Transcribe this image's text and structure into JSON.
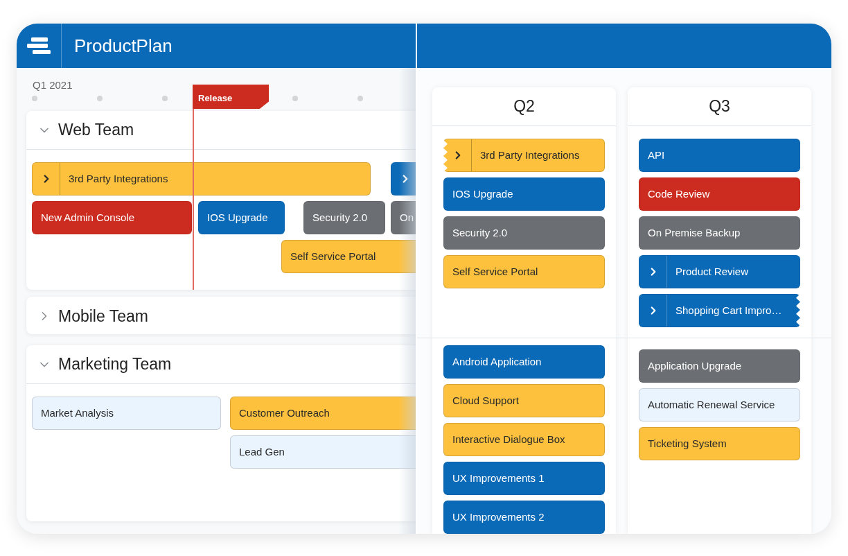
{
  "app": {
    "title": "ProductPlan"
  },
  "timeline": {
    "quarters": [
      "Q1 2021"
    ],
    "marker": {
      "label": "Release"
    },
    "teams": [
      {
        "name": "Web Team",
        "expanded": true,
        "bars": [
          {
            "label": "3rd Party Integrations",
            "color": "#fdc13e",
            "expandable": true
          },
          {
            "color": "#0b6ab7",
            "expandable": true
          },
          {
            "label": "New Admin Console",
            "color": "#cc2b1f",
            "expandable": false
          },
          {
            "label": "IOS Upgrade",
            "color": "#0b6ab7",
            "expandable": false
          },
          {
            "label": "Security 2.0",
            "color": "#6b6e72",
            "expandable": false
          },
          {
            "label": "On",
            "color": "#6b6e72",
            "expandable": false
          },
          {
            "label": "Self Service Portal",
            "color": "#fdc13e",
            "expandable": false
          }
        ]
      },
      {
        "name": "Mobile Team",
        "expanded": false
      },
      {
        "name": "Marketing Team",
        "expanded": true,
        "bars": [
          {
            "label": "Market Analysis",
            "color": "#eaf4fe",
            "expandable": false
          },
          {
            "label": "Customer Outreach",
            "color": "#fdc13e",
            "expandable": false
          },
          {
            "label": "Lead Gen",
            "color": "#eaf4fe",
            "expandable": false
          }
        ]
      }
    ]
  },
  "board": {
    "columns": [
      {
        "title": "Q2",
        "lanes": [
          {
            "cards": [
              {
                "label": "3rd Party Integrations",
                "color": "#fdc13e",
                "expandable": true,
                "torn_left": true,
                "torn_right": false
              },
              {
                "label": "IOS Upgrade",
                "color": "#0b6ab7",
                "expandable": false,
                "torn_left": false,
                "torn_right": false
              },
              {
                "label": "Security 2.0",
                "color": "#6b6e72",
                "expandable": false,
                "torn_left": false,
                "torn_right": false
              },
              {
                "label": "Self Service Portal",
                "color": "#fdc13e",
                "expandable": false,
                "torn_left": false,
                "torn_right": false
              }
            ]
          },
          {
            "cards": [
              {
                "label": "Android Application",
                "color": "#0b6ab7",
                "expandable": false,
                "torn_left": false,
                "torn_right": false
              },
              {
                "label": "Cloud Support",
                "color": "#fdc13e",
                "expandable": false,
                "torn_left": false,
                "torn_right": false
              },
              {
                "label": "Interactive Dialogue Box",
                "color": "#fdc13e",
                "expandable": false,
                "torn_left": false,
                "torn_right": false
              },
              {
                "label": "UX Improvements 1",
                "color": "#0b6ab7",
                "expandable": false,
                "torn_left": false,
                "torn_right": false
              },
              {
                "label": "UX Improvements 2",
                "color": "#0b6ab7",
                "expandable": false,
                "torn_left": false,
                "torn_right": false
              }
            ]
          }
        ]
      },
      {
        "title": "Q3",
        "lanes": [
          {
            "cards": [
              {
                "label": "API",
                "color": "#0b6ab7",
                "expandable": false,
                "torn_left": false,
                "torn_right": false
              },
              {
                "label": "Code Review",
                "color": "#cc2b1f",
                "expandable": false,
                "torn_left": false,
                "torn_right": false
              },
              {
                "label": "On Premise Backup",
                "color": "#6b6e72",
                "expandable": false,
                "torn_left": false,
                "torn_right": false
              },
              {
                "label": "Product Review",
                "color": "#0b6ab7",
                "expandable": true,
                "torn_left": false,
                "torn_right": false
              },
              {
                "label": "Shopping Cart Impro…",
                "color": "#0b6ab7",
                "expandable": true,
                "torn_left": false,
                "torn_right": true
              }
            ]
          },
          {
            "cards": [
              {
                "label": "Application Upgrade",
                "color": "#6b6e72",
                "expandable": false,
                "torn_left": false,
                "torn_right": false
              },
              {
                "label": "Automatic Renewal Service",
                "color": "#eaf4fe",
                "expandable": false,
                "torn_left": false,
                "torn_right": false
              },
              {
                "label": "Ticketing System",
                "color": "#fdc13e",
                "expandable": false,
                "torn_left": false,
                "torn_right": false
              }
            ]
          }
        ]
      }
    ]
  }
}
